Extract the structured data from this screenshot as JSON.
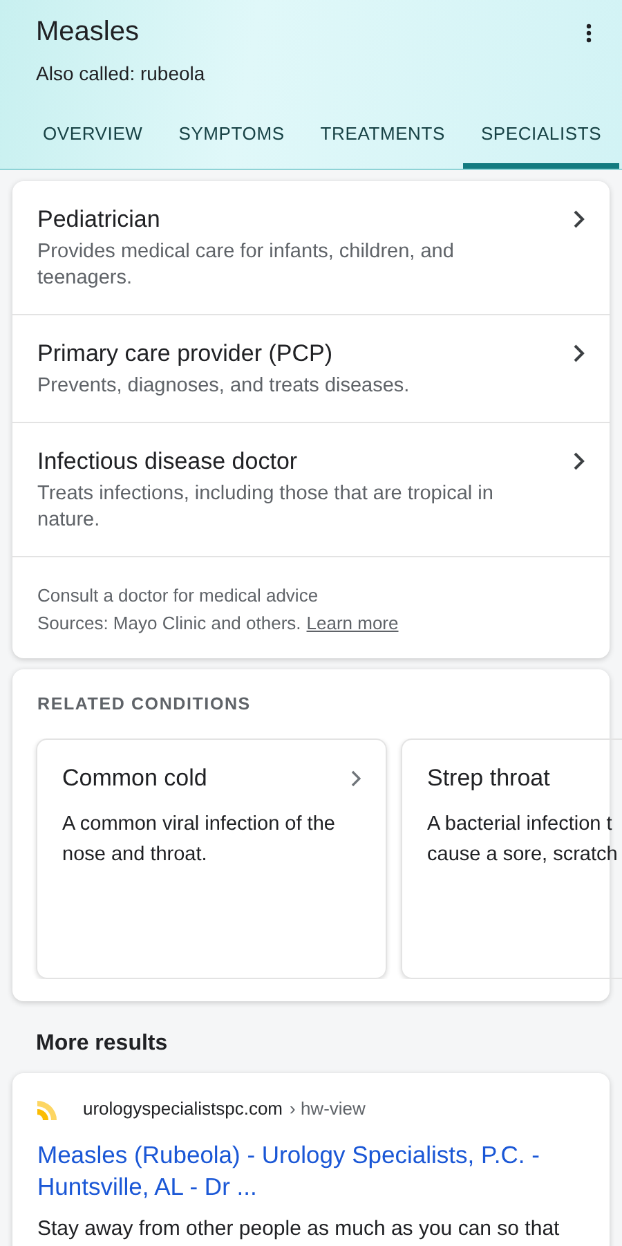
{
  "header": {
    "title": "Measles",
    "subtitle": "Also called: rubeola"
  },
  "tabs": [
    {
      "label": "OVERVIEW",
      "selected": false
    },
    {
      "label": "SYMPTOMS",
      "selected": false
    },
    {
      "label": "TREATMENTS",
      "selected": false
    },
    {
      "label": "SPECIALISTS",
      "selected": true
    }
  ],
  "specialists": [
    {
      "name": "Pediatrician",
      "description": "Provides medical care for infants, children, and teenagers."
    },
    {
      "name": "Primary care provider (PCP)",
      "description": "Prevents, diagnoses, and treats diseases."
    },
    {
      "name": "Infectious disease doctor",
      "description": "Treats infections, including those that are tropical in nature."
    }
  ],
  "disclaimer": {
    "note": "Consult a doctor for medical advice",
    "sources": "Sources: Mayo Clinic and others.",
    "link": "Learn more"
  },
  "related": {
    "heading": "RELATED CONDITIONS",
    "cards": [
      {
        "name": "Common cold",
        "description_lines": [
          "A common viral infection of the",
          "nose and throat."
        ]
      },
      {
        "name": "Strep throat",
        "description_lines": [
          "A bacterial infection t",
          "cause a sore, scratch"
        ]
      }
    ]
  },
  "more_results": {
    "heading": "More results",
    "result": {
      "site": "urologyspecialistspc.com",
      "path": "› hw-view",
      "title": "Measles (Rubeola) - Urology Specialists, P.C. - Huntsville, AL - Dr ...",
      "snippet": "Stay away from other people as much as you can so that"
    }
  }
}
